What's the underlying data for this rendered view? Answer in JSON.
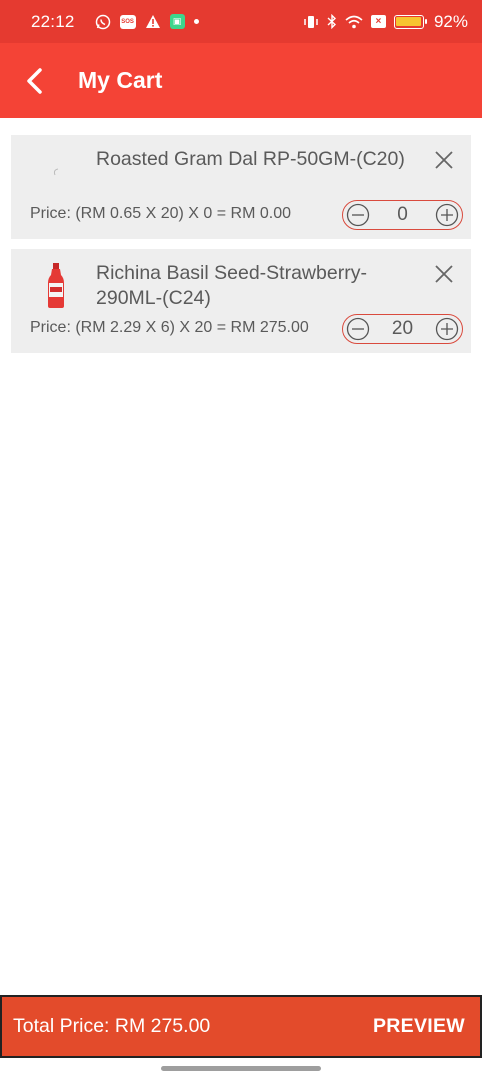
{
  "status_bar": {
    "time": "22:12",
    "battery_percent": "92%",
    "sos_label": "SOS"
  },
  "app_bar": {
    "title": "My Cart"
  },
  "cart": {
    "items": [
      {
        "name": "Roasted Gram Dal RP-50GM-(C20)",
        "price_line": "Price: (RM 0.65 X 20) X 0 = RM 0.00",
        "quantity": "0",
        "thumbnail": "product-placeholder"
      },
      {
        "name": "Richina Basil Seed-Strawberry-290ML-(C24)",
        "price_line": "Price: (RM 2.29 X 6) X 20 = RM 275.00",
        "quantity": "20",
        "thumbnail": "red-bottle"
      }
    ]
  },
  "footer": {
    "total_label": "Total Price: RM 275.00",
    "preview_label": "PREVIEW"
  },
  "colors": {
    "primary": "#f44336",
    "status_bar": "#e53a30",
    "footer": "#e34b2b",
    "stepper_border": "#d94a3d",
    "item_bg": "#eeeeee"
  }
}
